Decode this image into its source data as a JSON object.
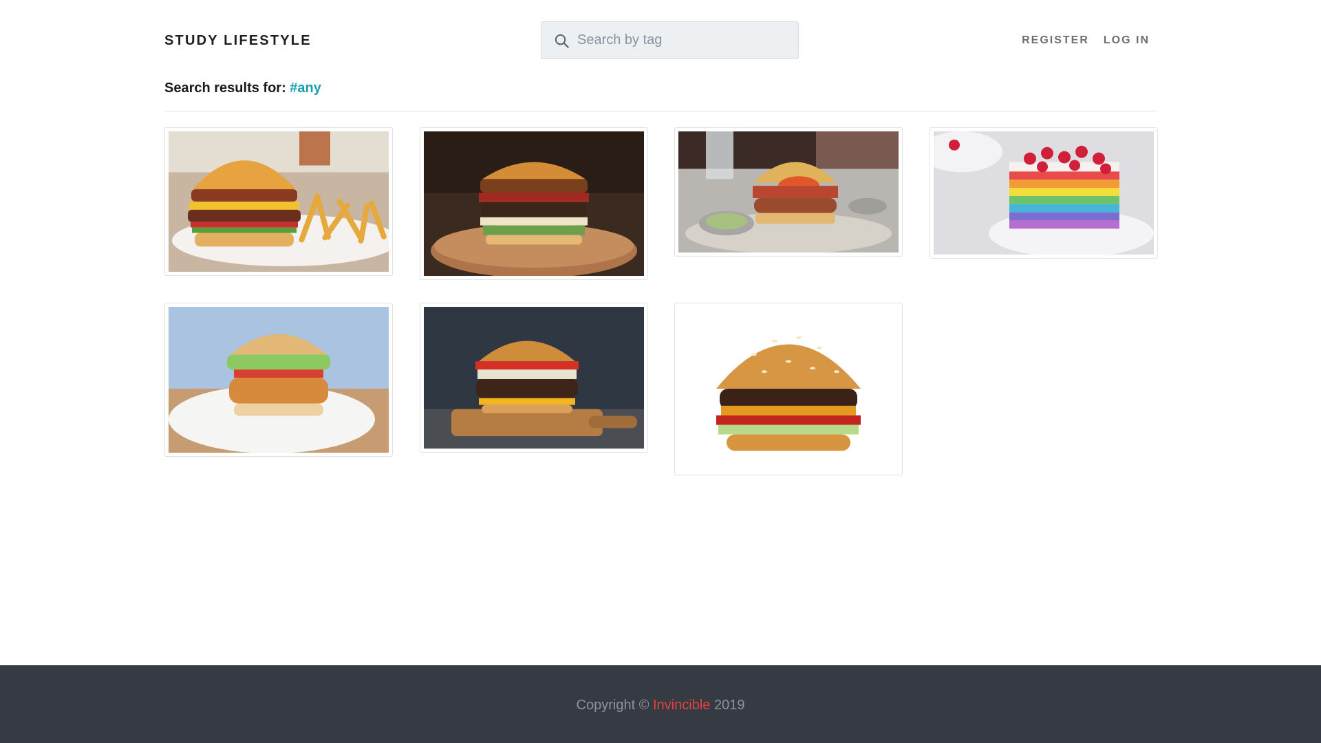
{
  "header": {
    "brand": "STUDY LIFESTYLE",
    "search": {
      "placeholder": "Search by tag",
      "value": "",
      "icon": "search-icon"
    },
    "nav": {
      "register": "REGISTER",
      "login": "LOG IN"
    }
  },
  "results": {
    "label": "Search results for:",
    "tag": "#any"
  },
  "gallery": [
    {
      "subject": "burger-fries"
    },
    {
      "subject": "burger-board"
    },
    {
      "subject": "burger-table"
    },
    {
      "subject": "rainbow-cake"
    },
    {
      "subject": "chicken-burger"
    },
    {
      "subject": "burger-dark"
    },
    {
      "subject": "burger-white"
    }
  ],
  "footer": {
    "prefix": "Copyright ©",
    "team": "Invincible",
    "year": "2019"
  },
  "colors": {
    "accent": "#1a9fb0",
    "footer_bg": "#363a43",
    "footer_highlight": "#e8423f"
  }
}
